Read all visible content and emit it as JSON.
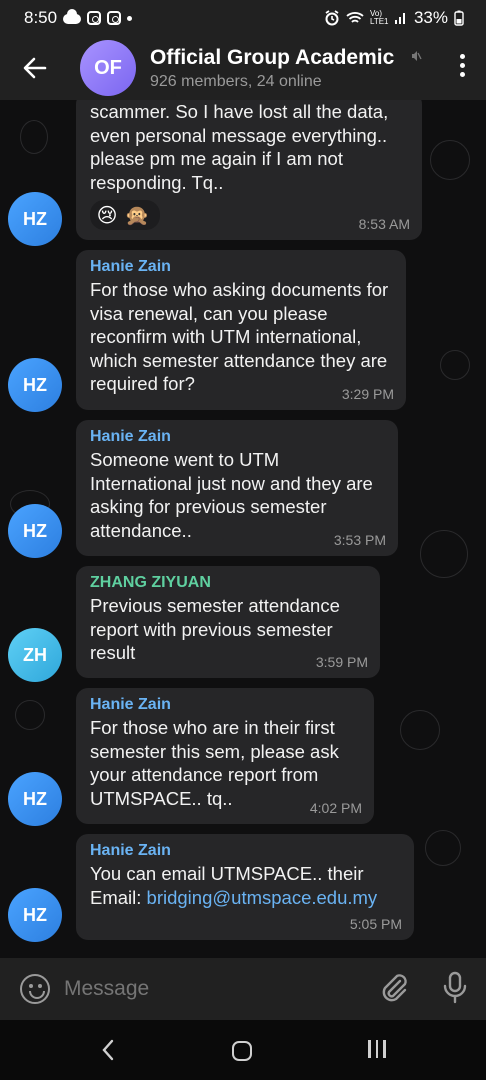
{
  "status": {
    "time": "8:50",
    "battery": "33%",
    "network_label": "Vo) LTE1"
  },
  "header": {
    "avatar_initials": "OF",
    "title": "Official Group Academic",
    "subtitle": "926 members, 24 online"
  },
  "messages": [
    {
      "sender": "",
      "avatar": "HZ",
      "lines": "scammer. So I have lost all the data, even personal message everything.. please pm me again if I am not responding. Tq..",
      "time": "8:53 AM",
      "reactions": [
        "😢",
        "🙊"
      ]
    },
    {
      "sender": "Hanie Zain",
      "avatar": "HZ",
      "lines": "For those who asking documents for visa renewal, can you please reconfirm with UTM international, which semester attendance they are required for?",
      "time": "3:29 PM"
    },
    {
      "sender": "Hanie Zain",
      "avatar": "HZ",
      "lines": "Someone went to UTM International just now and they are asking for previous semester attendance..",
      "time": "3:53 PM"
    },
    {
      "sender": "ZHANG ZIYUAN",
      "avatar": "ZH",
      "lines": "Previous semester attendance report with previous semester result",
      "time": "3:59 PM"
    },
    {
      "sender": "Hanie Zain",
      "avatar": "HZ",
      "lines": "For those who are in their first semester this sem, please ask your attendance report from UTMSPACE.. tq..",
      "time": "4:02 PM"
    },
    {
      "sender": "Hanie Zain",
      "avatar": "HZ",
      "text_prefix": "You can email UTMSPACE.. their Email: ",
      "link": "bridging@utmspace.edu.my",
      "time": "5:05 PM"
    }
  ],
  "input": {
    "placeholder": "Message"
  },
  "colors": {
    "header_bg": "#212121",
    "bubble_bg": "#262628",
    "name_blue": "#6ab3f3",
    "name_green": "#5fd0a0",
    "link": "#6ab3f3"
  }
}
